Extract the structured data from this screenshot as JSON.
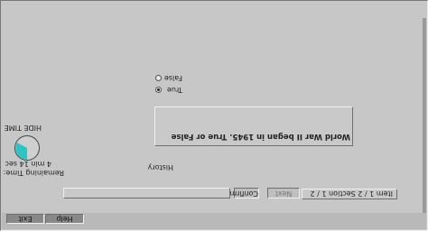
{
  "toolbar": {
    "exit_label": "Exit",
    "help_label": "Help"
  },
  "question": {
    "section_status": "Item 1 / 2  Section 1 / 2",
    "confirm_label": "Confirm",
    "next_label": "Next",
    "category": "History",
    "text": "World War II began in 1945. True or False",
    "options": [
      {
        "label": "True",
        "selected": true
      },
      {
        "label": "False",
        "selected": false
      }
    ]
  },
  "timer": {
    "remaining_label": "Remaining Time:",
    "remaining_value": "4 min 14 sec",
    "hide_label": "HIDE TIME",
    "accent_color": "#2ec4c4"
  }
}
